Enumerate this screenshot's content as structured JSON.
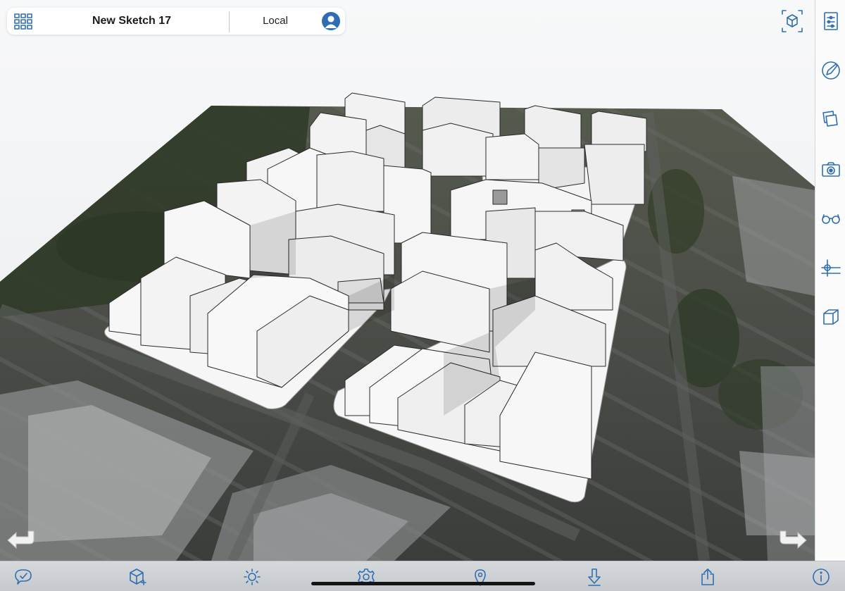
{
  "app": {
    "sketch_title": "New Sketch 17",
    "location_label": "Local"
  },
  "icons": {
    "header": [
      "grid-menu-icon",
      "account-icon"
    ],
    "top_right": [
      "view-cube-icon"
    ],
    "right_toolbar": [
      "sliders-icon",
      "pencil-icon",
      "layers-icon",
      "camera-icon",
      "glasses-icon",
      "axes-icon",
      "solid-icon"
    ],
    "bottom_toolbar": [
      "chat-icon",
      "add-object-icon",
      "sun-icon",
      "gear-icon",
      "location-pin-icon",
      "download-icon",
      "share-icon",
      "info-icon"
    ],
    "navigation": [
      "undo-arrow-icon",
      "redo-arrow-icon"
    ]
  },
  "colors": {
    "accent": "#2f6fb0",
    "toolbar_bg": "#fbfbfb",
    "bottom_bar_bg": "#d0d3d6",
    "building_white": "#f4f4f4",
    "ground_dark": "#3c4038"
  }
}
